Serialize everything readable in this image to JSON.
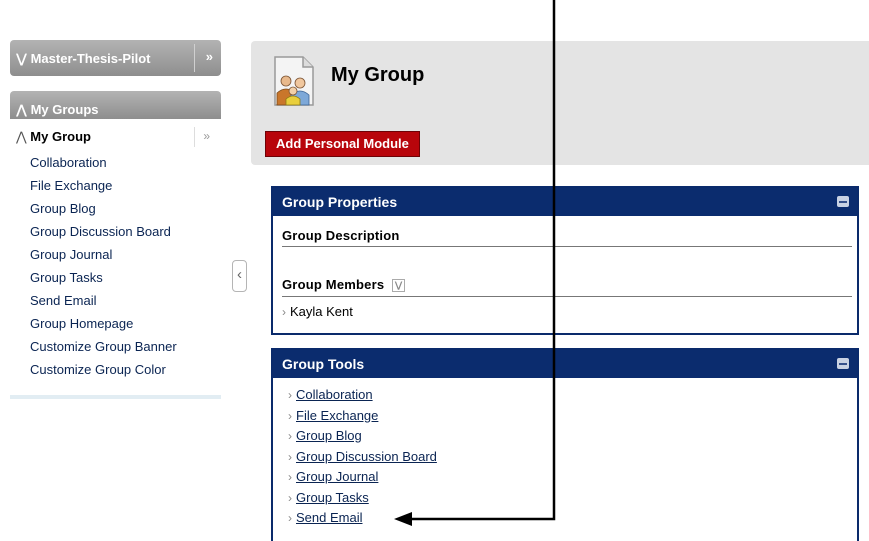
{
  "sidebar": {
    "course_title": "Master-Thesis-Pilot",
    "groups_title": "My Groups",
    "group_title": "My Group",
    "items": [
      "Collaboration",
      "File Exchange",
      "Group Blog",
      "Group Discussion Board",
      "Group Journal",
      "Group Tasks",
      "Send Email",
      "Group Homepage",
      "Customize Group Banner",
      "Customize Group Color"
    ]
  },
  "page": {
    "title": "My Group",
    "add_module_label": "Add Personal Module"
  },
  "group_properties": {
    "title": "Group Properties",
    "description_label": "Group Description",
    "members_label": "Group Members",
    "members": [
      "Kayla Kent"
    ]
  },
  "group_tools": {
    "title": "Group Tools",
    "links": [
      "Collaboration",
      "File Exchange",
      "Group Blog",
      "Group Discussion Board",
      "Group Journal",
      "Group Tasks",
      "Send Email"
    ]
  },
  "colors": {
    "module_header": "#0b2c6e",
    "add_button": "#b8050b",
    "sidebar_header": "#a0a0a0",
    "link": "#0a2452"
  },
  "icons": {
    "course_header": "double-chevron-down-icon",
    "course_expand": "double-chevron-right-icon",
    "groups_header": "double-chevron-up-icon",
    "group_expand": "double-chevron-right-icon",
    "collapse_handle": "chevron-left-icon",
    "module_minimize": "minimize-icon",
    "page_icon": "group-people-icon",
    "annotation": "arrow-left-icon"
  }
}
